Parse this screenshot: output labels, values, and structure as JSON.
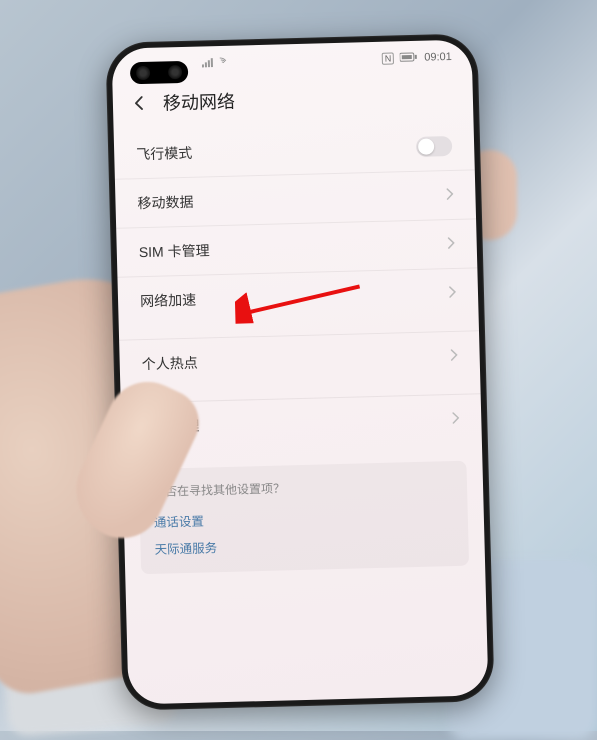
{
  "status": {
    "signal": "⁴ᴳ",
    "wifi": "wifi",
    "nfc": "N",
    "battery": "▮",
    "time": "09:01"
  },
  "header": {
    "title": "移动网络"
  },
  "items": {
    "airplane": "飞行模式",
    "mobile_data": "移动数据",
    "sim": "SIM 卡管理",
    "net_accel": "网络加速",
    "hotspot": "个人热点",
    "traffic": "流量管理"
  },
  "footer": {
    "prompt": "是否在寻找其他设置项？",
    "link1": "通话设置",
    "link2": "天际通服务"
  }
}
